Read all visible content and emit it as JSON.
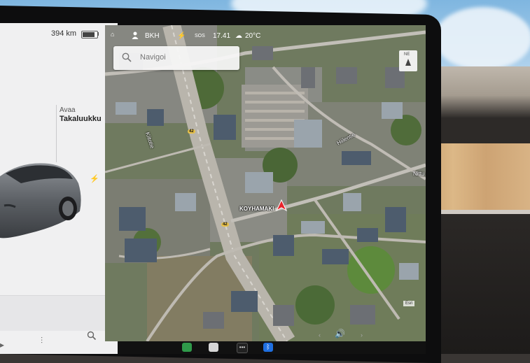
{
  "left_panel": {
    "range": "394 km",
    "battery_level": 0.85,
    "trunk_action": "Avaa",
    "trunk_label": "Takaluukku",
    "bolt_icon": "lightning-bolt-icon"
  },
  "status_bar": {
    "profile_name": "BKH",
    "time": "17.41",
    "sos": "SOS",
    "temperature": "20°C",
    "icons": [
      "person-icon",
      "charging-icon",
      "sos-icon",
      "weather-icon"
    ]
  },
  "search": {
    "placeholder": "Navigoi"
  },
  "compass": {
    "label": "NE"
  },
  "map": {
    "place_label": "KOYHAMAKI",
    "street_labels": [
      "Kiitotie",
      "Hiilentie",
      "Nittu"
    ],
    "road_shields": [
      "42",
      "42"
    ],
    "attribution": "Esri"
  },
  "colors": {
    "nav_arrow": "#e8242c",
    "panel_bg": "#f0f0f1",
    "search_bg": "#f6f6f6"
  }
}
